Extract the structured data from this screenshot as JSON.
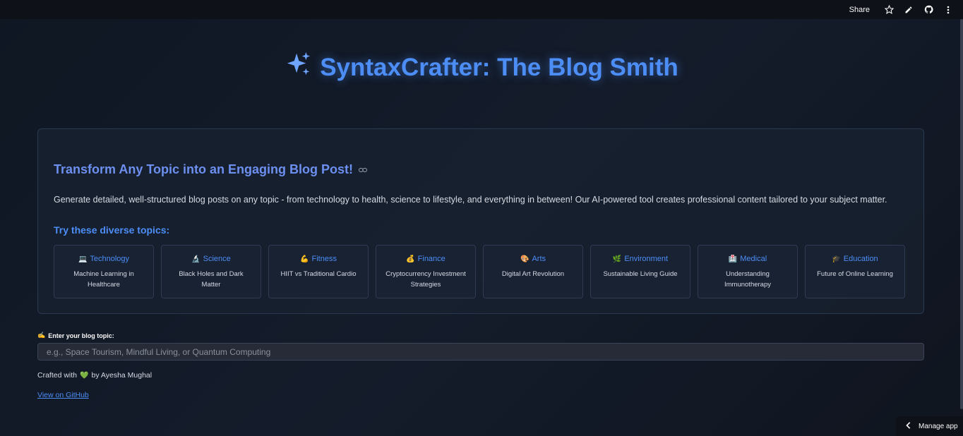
{
  "topbar": {
    "share_label": "Share",
    "icons": [
      "star-icon",
      "pencil-icon",
      "github-icon",
      "more-vertical-icon"
    ]
  },
  "header": {
    "icon": "sparkles-icon",
    "title": "SyntaxCrafter: The Blog Smith"
  },
  "intro": {
    "heading": "Transform Any Topic into an Engaging Blog Post!",
    "description": "Generate detailed, well-structured blog posts on any topic - from technology to health, science to lifestyle, and everything in between! Our AI-powered tool creates professional content tailored to your subject matter.",
    "topics_heading": "Try these diverse topics:",
    "topics": [
      {
        "emoji": "💻",
        "category": "Technology",
        "example": "Machine Learning in Healthcare"
      },
      {
        "emoji": "🔬",
        "category": "Science",
        "example": "Black Holes and Dark Matter"
      },
      {
        "emoji": "💪",
        "category": "Fitness",
        "example": "HIIT vs Traditional Cardio"
      },
      {
        "emoji": "💰",
        "category": "Finance",
        "example": "Cryptocurrency Investment Strategies"
      },
      {
        "emoji": "🎨",
        "category": "Arts",
        "example": "Digital Art Revolution"
      },
      {
        "emoji": "🌿",
        "category": "Environment",
        "example": "Sustainable Living Guide"
      },
      {
        "emoji": "🏥",
        "category": "Medical",
        "example": "Understanding Immunotherapy"
      },
      {
        "emoji": "🎓",
        "category": "Education",
        "example": "Future of Online Learning"
      }
    ]
  },
  "form": {
    "label_emoji": "✍️",
    "label": "Enter your blog topic:",
    "placeholder": "e.g., Space Tourism, Mindful Living, or Quantum Computing",
    "value": ""
  },
  "footer": {
    "crafted_prefix": "Crafted with",
    "heart": "💚",
    "crafted_suffix": "by Ayesha Mughal",
    "github_link": "View on GitHub"
  },
  "manage_app": "Manage app",
  "colors": {
    "accent": "#4c8df6",
    "heading": "#6d8ff0",
    "background": "#121a27",
    "card_border": "#2a3850"
  }
}
